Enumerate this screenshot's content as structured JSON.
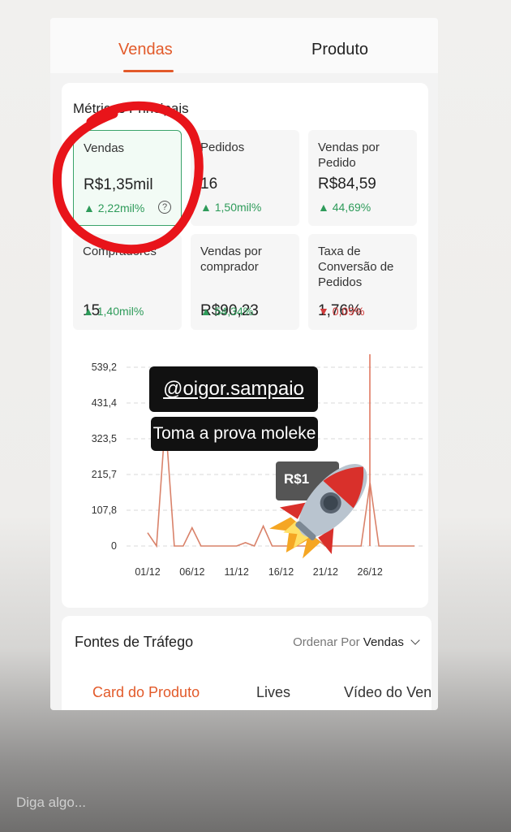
{
  "tabs": {
    "active": "Vendas",
    "inactive": "Produto"
  },
  "metrics": {
    "title": "Métricas Principais",
    "items": [
      {
        "label": "Vendas",
        "value": "R$1,35mil",
        "change": "2,22mil%",
        "trend": "up",
        "help": "?"
      },
      {
        "label": "Pedidos",
        "value": "16",
        "change": "1,50mil%",
        "trend": "up"
      },
      {
        "label": "Vendas por Pedido",
        "value": "R$84,59",
        "change": "44,69%",
        "trend": "up"
      },
      {
        "label": "Compradores",
        "value": "15",
        "change": "1,40mil%",
        "trend": "up"
      },
      {
        "label": "Vendas por comprador",
        "value": "R$90,23",
        "change": "54,34%",
        "trend": "up"
      },
      {
        "label": "Taxa de Conversão de Pedidos",
        "value": "1,76%",
        "change": "0,09%",
        "trend": "down"
      }
    ]
  },
  "chart_data": {
    "type": "line",
    "y_ticks": [
      "539,2",
      "431,4",
      "323,5",
      "215,7",
      "107,8",
      "0"
    ],
    "x_ticks": [
      "01/12",
      "06/12",
      "11/12",
      "16/12",
      "21/12",
      "26/12"
    ],
    "ylim": [
      0,
      539.2
    ],
    "x": [
      1,
      2,
      3,
      4,
      5,
      6,
      7,
      8,
      9,
      10,
      11,
      12,
      13,
      14,
      15,
      16,
      17,
      18,
      19,
      20,
      21,
      22,
      23,
      24,
      25,
      26,
      27,
      28,
      29,
      30,
      31
    ],
    "values": [
      40,
      0,
      380,
      0,
      0,
      55,
      0,
      0,
      0,
      0,
      0,
      10,
      0,
      60,
      0,
      0,
      0,
      0,
      0,
      20,
      0,
      0,
      0,
      0,
      0,
      190,
      0,
      0,
      0,
      0,
      0
    ],
    "line_color": "#d9826a",
    "grid": true
  },
  "tooltip": {
    "text": "R$1"
  },
  "overlay": {
    "handle": "@oigor.sampaio",
    "caption": "Toma a prova moleke"
  },
  "traffic": {
    "title": "Fontes de Tráfego",
    "sort_label": "Ordenar Por",
    "sort_value": "Vendas",
    "tabs": [
      "Card do Produto",
      "Lives",
      "Vídeo do Ven"
    ]
  },
  "reply": {
    "placeholder": "Diga algo..."
  },
  "colors": {
    "accent": "#e25a2a",
    "positive": "#2e9b5a",
    "negative": "#d23c3c",
    "annotation": "#e8141a"
  }
}
